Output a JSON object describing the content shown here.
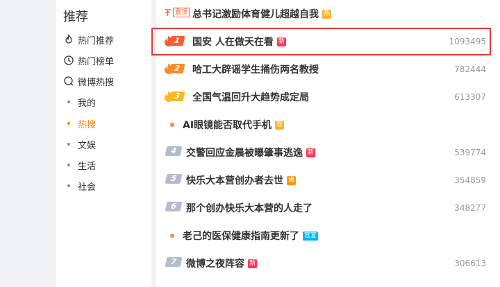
{
  "sidebar": {
    "title": "推荐",
    "nav": [
      {
        "label": "热门推荐",
        "icon": "flame-outline-icon"
      },
      {
        "label": "热门榜单",
        "icon": "clock-outline-icon"
      },
      {
        "label": "微博热搜",
        "icon": "search-outline-icon"
      }
    ],
    "sub": [
      {
        "label": "我的",
        "active": false
      },
      {
        "label": "热搜",
        "active": true
      },
      {
        "label": "文娱",
        "active": false
      },
      {
        "label": "生活",
        "active": false
      },
      {
        "label": "社会",
        "active": false
      }
    ]
  },
  "hot_list": {
    "pinned": {
      "pin_label": "置顶",
      "title": "总书记激励体育健儿超越自我",
      "badge": "热"
    },
    "items": [
      {
        "rank": "1",
        "title": "国安 人在做天在看",
        "badge": "新",
        "count": "1093495"
      },
      {
        "rank": "2",
        "title": "哈工大辟谣学生捅伤两名教授",
        "badge": "",
        "count": "782444"
      },
      {
        "rank": "3",
        "title": "全国气温回升大趋势成定局",
        "badge": "",
        "count": "613307"
      },
      {
        "rank": "",
        "title": "AI眼镜能否取代手机",
        "badge": "荐",
        "count": ""
      },
      {
        "rank": "4",
        "title": "交警回应金晨被曝肇事逃逸",
        "badge": "新",
        "count": "539774"
      },
      {
        "rank": "5",
        "title": "快乐大本营创办者去世",
        "badge": "沸",
        "count": "354859"
      },
      {
        "rank": "6",
        "title": "那个创办快乐大本营的人走了",
        "badge": "",
        "count": "348277"
      },
      {
        "rank": "",
        "title": "老己的医保健康指南更新了",
        "badge": "官宣",
        "count": ""
      },
      {
        "rank": "7",
        "title": "微博之夜阵容",
        "badge": "新",
        "count": "306613"
      }
    ]
  },
  "colors": {
    "accent": "#ff8200",
    "highlight_border": "#e53935"
  }
}
